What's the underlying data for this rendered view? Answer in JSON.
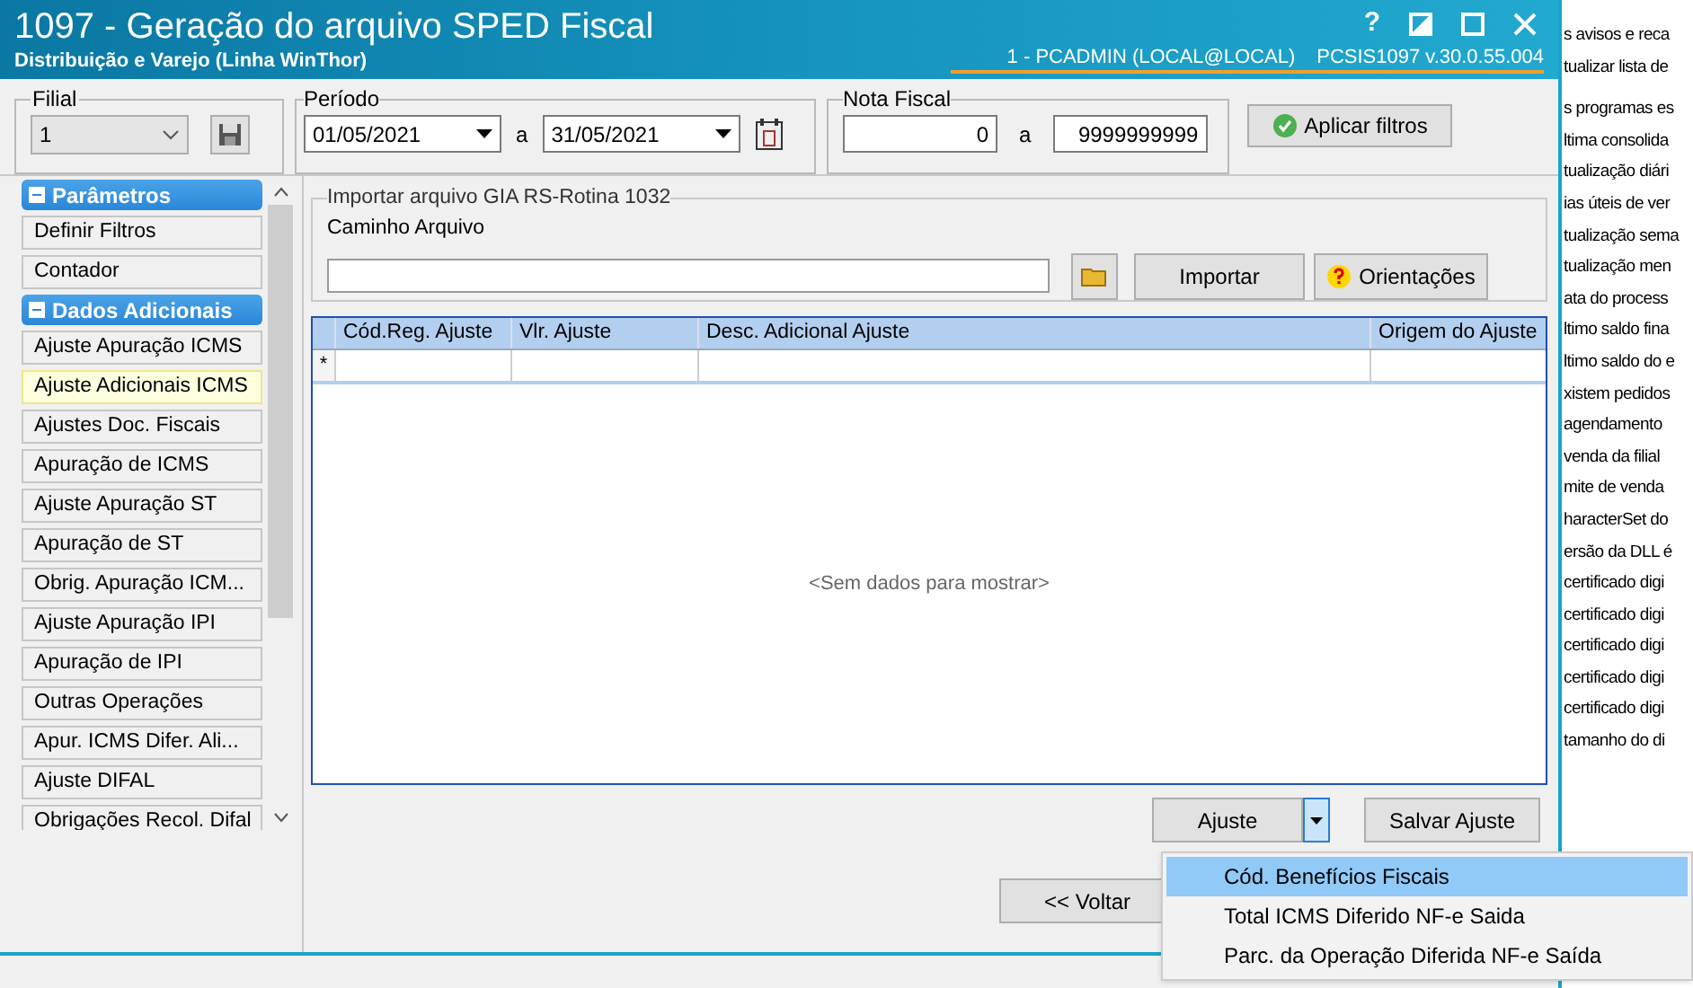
{
  "window": {
    "title": "1097 - Geração do arquivo SPED Fiscal",
    "subtitle": "Distribuição e Varejo (Linha WinThor)",
    "help": "?",
    "user": "1 - PCADMIN (LOCAL@LOCAL)",
    "version": "PCSIS1097  v.30.0.55.004"
  },
  "filters": {
    "filial": {
      "label": "Filial",
      "value": "1"
    },
    "periodo": {
      "label": "Período",
      "from": "01/05/2021",
      "sep": "a",
      "to": "31/05/2021"
    },
    "nota": {
      "label": "Nota Fiscal",
      "from": "0",
      "sep": "a",
      "to": "9999999999"
    },
    "apply": "Aplicar filtros"
  },
  "sidebar": {
    "sections": [
      {
        "title": "Parâmetros",
        "expanded": true,
        "items": [
          {
            "label": "Definir Filtros",
            "selected": false
          },
          {
            "label": "Contador",
            "selected": false
          }
        ]
      },
      {
        "title": "Dados Adicionais",
        "expanded": true,
        "items": [
          {
            "label": "Ajuste Apuração ICMS",
            "selected": false
          },
          {
            "label": "Ajuste Adicionais ICMS",
            "selected": true
          },
          {
            "label": "Ajustes Doc. Fiscais",
            "selected": false
          },
          {
            "label": "Apuração de ICMS",
            "selected": false
          },
          {
            "label": "Ajuste Apuração ST",
            "selected": false
          },
          {
            "label": "Apuração de ST",
            "selected": false
          },
          {
            "label": "Obrig. Apuração ICM...",
            "selected": false
          },
          {
            "label": "Ajuste Apuração IPI",
            "selected": false
          },
          {
            "label": "Apuração de IPI",
            "selected": false
          },
          {
            "label": "Outras Operações",
            "selected": false
          },
          {
            "label": "Apur. ICMS Difer. Ali...",
            "selected": false
          },
          {
            "label": "Ajuste DIFAL",
            "selected": false
          },
          {
            "label": "Obrigações Recol. Difal",
            "selected": false
          }
        ]
      }
    ]
  },
  "import": {
    "title": "Importar arquivo GIA RS-Rotina 1032",
    "path_label": "Caminho Arquivo",
    "import_button": "Importar",
    "help_button": "Orientações"
  },
  "table": {
    "columns": [
      "Cód.Reg. Ajuste",
      "Vlr. Ajuste",
      "Desc. Adicional Ajuste",
      "Origem do Ajuste"
    ],
    "new_row_marker": "*",
    "empty_text": "<Sem dados para mostrar>"
  },
  "actions": {
    "ajuste": "Ajuste",
    "save": "Salvar Ajuste",
    "back": "<< Voltar"
  },
  "menu": {
    "items": [
      {
        "label": "Cód. Benefícios Fiscais",
        "selected": true
      },
      {
        "label": "Total ICMS Diferido NF-e Saida",
        "selected": false
      },
      {
        "label": "Parc. da Operação Diferida NF-e Saída",
        "selected": false
      }
    ]
  },
  "background_text": {
    "top": [
      "s avisos e reca",
      "tualizar lista de"
    ],
    "lines": [
      "s programas es",
      "ltima consolida",
      "tualização diári",
      "ias úteis de ver",
      "tualização sema",
      "tualização men",
      "ata do process",
      "ltimo saldo fina",
      "ltimo saldo do e",
      "xistem pedidos",
      "agendamento",
      "venda da filial",
      "mite de venda",
      "haracterSet do",
      "ersão da DLL é",
      "certificado digi",
      "certificado digi",
      "certificado digi",
      "certificado digi",
      "certificado digi",
      "tamanho do di"
    ]
  }
}
